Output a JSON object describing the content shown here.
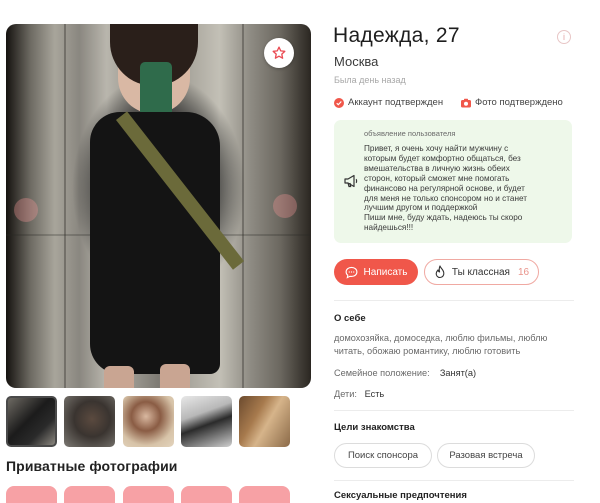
{
  "profile": {
    "name_age": "Надежда, 27",
    "city": "Москва",
    "last_seen": "Была день назад",
    "verified_account": "Аккаунт подтвержден",
    "verified_photo": "Фото подтверждено"
  },
  "ad": {
    "label": "объявление пользователя",
    "text": "Привет, я очень хочу найти мужчину с\nкоторым будет комфортно общаться, без\nвмешательства в личную жизнь обеих\nсторон, который сможет мне помогать\nфинансово на регулярной основе, и будет\nдля меня не только спонсором но и станет\nлучшим другом и поддержкой\nПиши мне, буду ждать, надеюсь ты скоро\nнайдешься!!!"
  },
  "actions": {
    "message_label": "Написать",
    "like_label": "Ты классная",
    "like_count": "16",
    "info_icon": "i"
  },
  "about": {
    "title": "О себе",
    "text": "домохозяйка, домоседка, люблю фильмы, люблю читать, обожаю романтику, люблю готовить",
    "marital_label": "Семейное положение:",
    "marital_value": "Занят(а)",
    "kids_label": "Дети:",
    "kids_value": "Есть"
  },
  "goals": {
    "title": "Цели знакомства",
    "chips": [
      "Поиск спонсора",
      "Разовая встреча"
    ]
  },
  "preferences": {
    "title": "Сексуальные предпочтения"
  },
  "photos": {
    "private_title": "Приватные фотографии"
  },
  "colors": {
    "accent": "#f0574a",
    "ad_background": "#eef8ea",
    "private_tile": "#f7a1a5"
  },
  "icons": {
    "favorite": "star-icon",
    "verified_account": "check-circle-icon",
    "verified_photo": "camera-icon",
    "ad": "megaphone-icon",
    "message": "chat-icon",
    "like": "flame-icon",
    "info": "info-icon"
  }
}
